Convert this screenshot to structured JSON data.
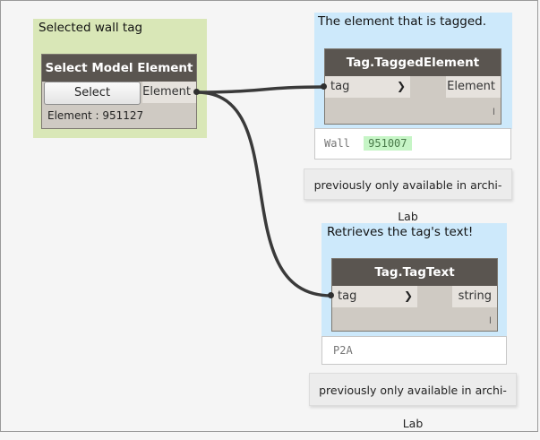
{
  "groups": {
    "selected": {
      "title": "Selected wall tag",
      "color": "#d9e7b7"
    },
    "tagged": {
      "title": "The element that is tagged.",
      "color": "#cde9fb"
    },
    "tagtext": {
      "title": "Retrieves the tag's text!",
      "color": "#cde9fb"
    }
  },
  "select_node": {
    "title": "Select Model Element",
    "button_label": "Select",
    "output_label": "Element",
    "status": "Element : 951127"
  },
  "tagged_node": {
    "title": "Tag.TaggedElement",
    "input_label": "tag",
    "output_label": "Element",
    "lacing": "l",
    "preview_type": "Wall",
    "preview_id": "951007"
  },
  "tagtext_node": {
    "title": "Tag.TagText",
    "input_label": "tag",
    "output_label": "string",
    "lacing": "l",
    "preview_value": "P2A"
  },
  "notes": {
    "note1": "previously only available in archi-Lab",
    "note2": "previously only available in archi-Lab"
  }
}
